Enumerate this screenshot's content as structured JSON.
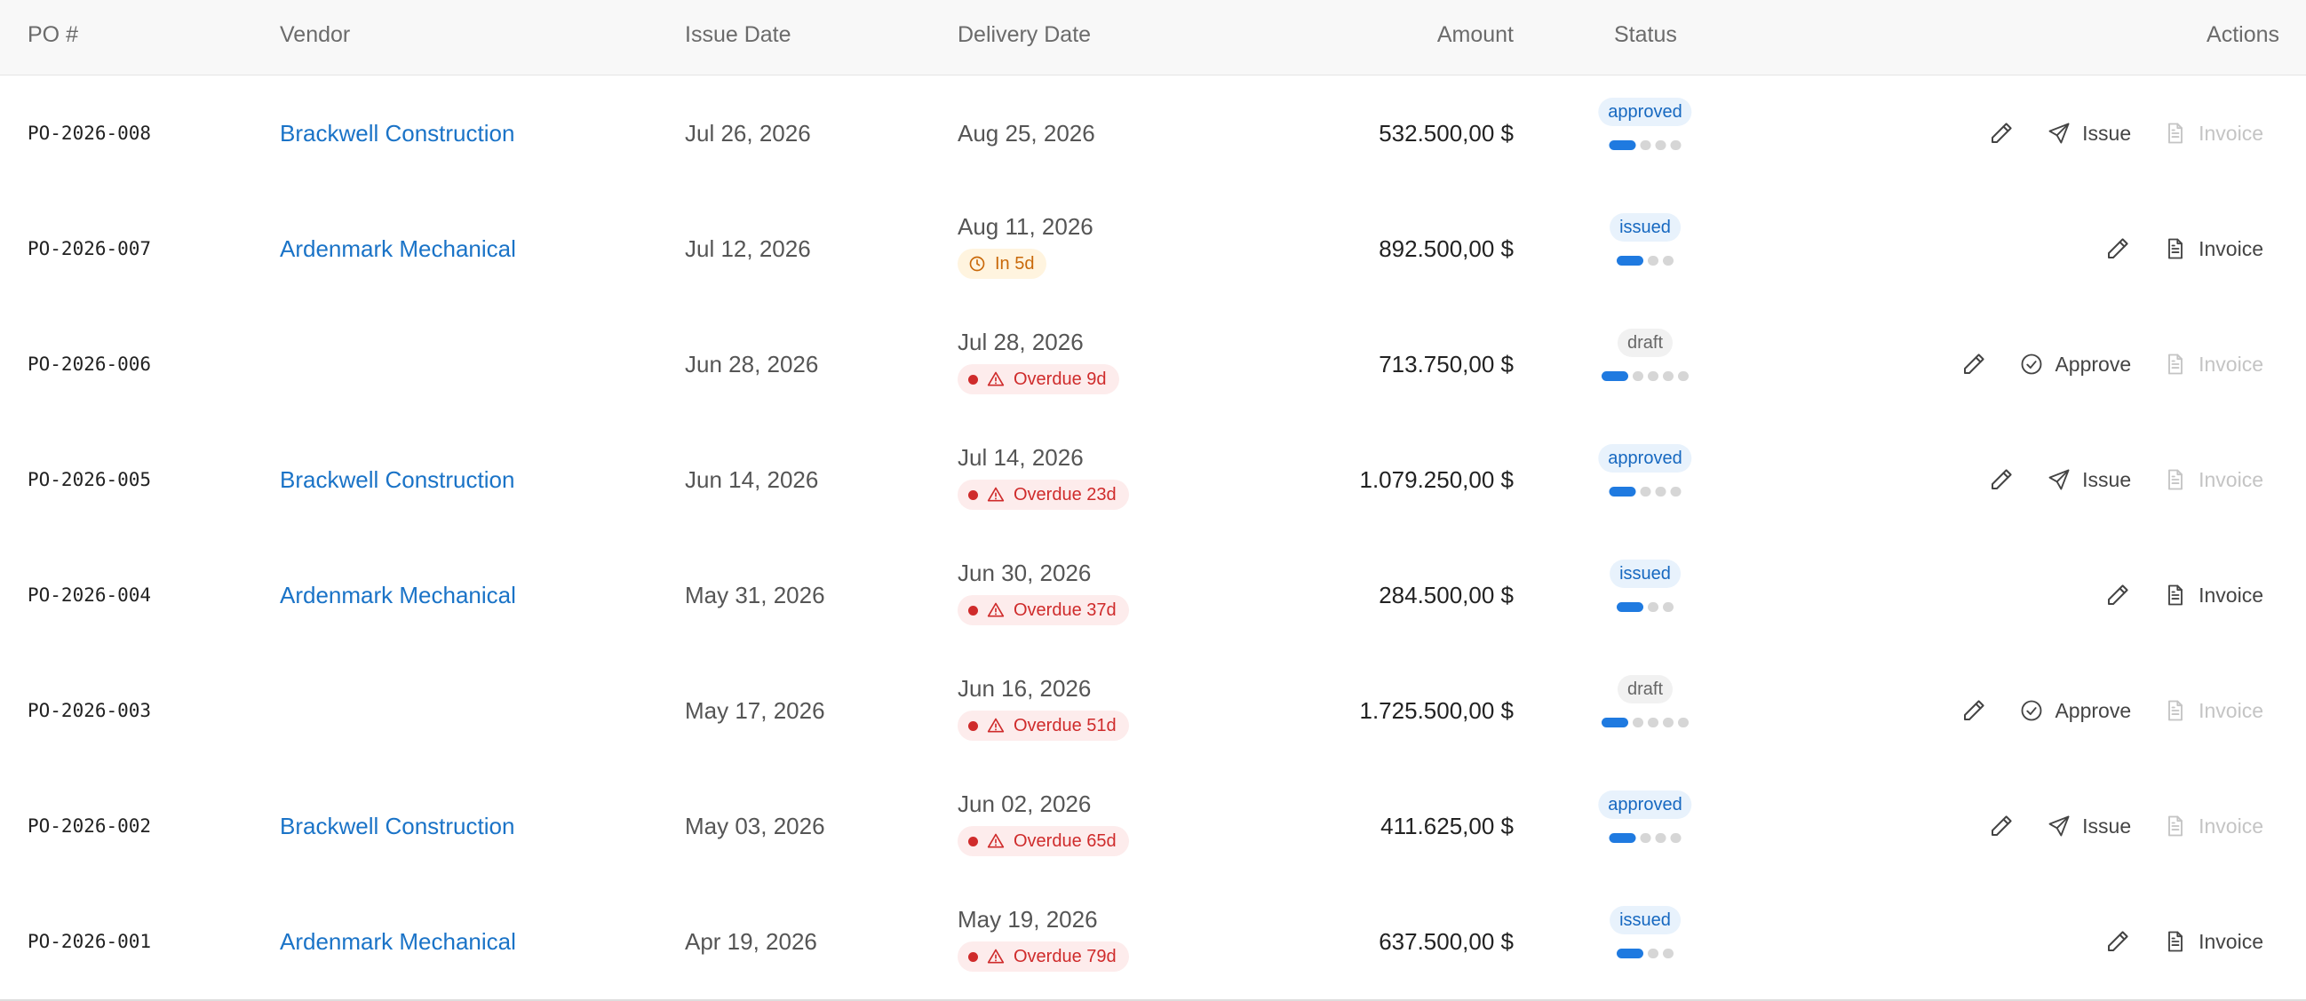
{
  "columns": {
    "po": "PO #",
    "vendor": "Vendor",
    "issue_date": "Issue Date",
    "delivery_date": "Delivery Date",
    "amount": "Amount",
    "status": "Status",
    "actions": "Actions"
  },
  "colors": {
    "link": "#1a73c7",
    "progress_on": "#1f7ae0",
    "overdue": "#cf2b2b",
    "due_soon": "#c9690a"
  },
  "icons": {
    "edit": "pencil-icon",
    "issue": "send-icon",
    "approve": "check-circle-icon",
    "invoice": "document-icon",
    "due_soon": "clock-icon",
    "overdue": "alert-triangle-icon"
  },
  "action_labels": {
    "issue": "Issue",
    "approve": "Approve",
    "invoice": "Invoice"
  },
  "rows": [
    {
      "po": "PO-2026-008",
      "vendor": "Brackwell Construction",
      "issue_date": "Jul 26, 2026",
      "delivery_date": "Aug 25, 2026",
      "due_label": "",
      "due_type": "",
      "amount": "532.500,00 $",
      "status": "approved",
      "progress": {
        "done": 1,
        "total": 4
      },
      "primary_action": "issue",
      "invoice_enabled": false
    },
    {
      "po": "PO-2026-007",
      "vendor": "Ardenmark Mechanical",
      "issue_date": "Jul 12, 2026",
      "delivery_date": "Aug 11, 2026",
      "due_label": "In 5d",
      "due_type": "warn",
      "amount": "892.500,00 $",
      "status": "issued",
      "progress": {
        "done": 1,
        "total": 3
      },
      "primary_action": "",
      "invoice_enabled": true
    },
    {
      "po": "PO-2026-006",
      "vendor": "",
      "issue_date": "Jun 28, 2026",
      "delivery_date": "Jul 28, 2026",
      "due_label": "Overdue 9d",
      "due_type": "over",
      "amount": "713.750,00 $",
      "status": "draft",
      "progress": {
        "done": 1,
        "total": 5
      },
      "primary_action": "approve",
      "invoice_enabled": false
    },
    {
      "po": "PO-2026-005",
      "vendor": "Brackwell Construction",
      "issue_date": "Jun 14, 2026",
      "delivery_date": "Jul 14, 2026",
      "due_label": "Overdue 23d",
      "due_type": "over",
      "amount": "1.079.250,00 $",
      "status": "approved",
      "progress": {
        "done": 1,
        "total": 4
      },
      "primary_action": "issue",
      "invoice_enabled": false
    },
    {
      "po": "PO-2026-004",
      "vendor": "Ardenmark Mechanical",
      "issue_date": "May 31, 2026",
      "delivery_date": "Jun 30, 2026",
      "due_label": "Overdue 37d",
      "due_type": "over",
      "amount": "284.500,00 $",
      "status": "issued",
      "progress": {
        "done": 1,
        "total": 3
      },
      "primary_action": "",
      "invoice_enabled": true
    },
    {
      "po": "PO-2026-003",
      "vendor": "",
      "issue_date": "May 17, 2026",
      "delivery_date": "Jun 16, 2026",
      "due_label": "Overdue 51d",
      "due_type": "over",
      "amount": "1.725.500,00 $",
      "status": "draft",
      "progress": {
        "done": 1,
        "total": 5
      },
      "primary_action": "approve",
      "invoice_enabled": false
    },
    {
      "po": "PO-2026-002",
      "vendor": "Brackwell Construction",
      "issue_date": "May 03, 2026",
      "delivery_date": "Jun 02, 2026",
      "due_label": "Overdue 65d",
      "due_type": "over",
      "amount": "411.625,00 $",
      "status": "approved",
      "progress": {
        "done": 1,
        "total": 4
      },
      "primary_action": "issue",
      "invoice_enabled": false
    },
    {
      "po": "PO-2026-001",
      "vendor": "Ardenmark Mechanical",
      "issue_date": "Apr 19, 2026",
      "delivery_date": "May 19, 2026",
      "due_label": "Overdue 79d",
      "due_type": "over",
      "amount": "637.500,00 $",
      "status": "issued",
      "progress": {
        "done": 1,
        "total": 3
      },
      "primary_action": "",
      "invoice_enabled": true
    }
  ]
}
